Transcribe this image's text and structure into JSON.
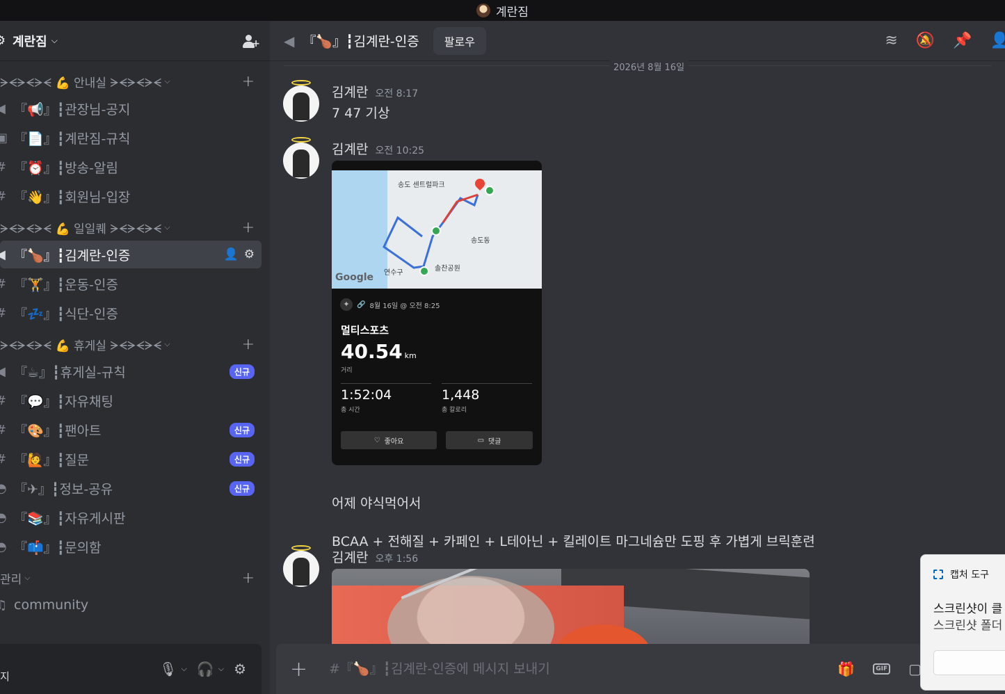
{
  "window": {
    "title": "계란짐"
  },
  "server": {
    "name": "계란짐"
  },
  "categories": [
    {
      "label": "ᗒᗕᗒᗕᗒᗕ 💪 안내실 ᗒᗕᗒᗕᗒᗕ"
    },
    {
      "label": "ᗒᗕᗒᗕᗒᗕ 💪 일일퀘 ᗒᗕᗒᗕᗒᗕ"
    },
    {
      "label": "ᗒᗕᗒᗕᗒᗕ 💪 휴게실 ᗒᗕᗒᗕᗒᗕ"
    },
    {
      "label": "관리"
    }
  ],
  "channels": {
    "info": [
      {
        "icon": "📢",
        "name": "『📢』┇관장님-공지"
      },
      {
        "icon": "📄",
        "name": "『📄』┇계란짐-규칙"
      },
      {
        "icon": "#",
        "name": "『⏰』┇방송-알림"
      },
      {
        "icon": "#",
        "name": "『👋』┇회원님-입장"
      }
    ],
    "daily": [
      {
        "icon": "📢",
        "name": "『🍗』┇김계란-인증"
      },
      {
        "icon": "#",
        "name": "『🏋』┇운동-인증"
      },
      {
        "icon": "#",
        "name": "『💤』┇식단-인증"
      }
    ],
    "lounge": [
      {
        "icon": "📢",
        "name": "『☕』┇휴게실-규칙",
        "badge": "신규"
      },
      {
        "icon": "#",
        "name": "『💬』┇자유채팅"
      },
      {
        "icon": "#",
        "name": "『🎨』┇팬아트",
        "badge": "신규"
      },
      {
        "icon": "💬",
        "name": "『🙋』┇질문",
        "badge": "신규"
      },
      {
        "icon": "💬",
        "name": "『✈』┇정보-공유",
        "badge": "신규"
      },
      {
        "icon": "💬",
        "name": "『📚』┇자유게시판"
      },
      {
        "icon": "💬",
        "name": "『📫』┇문의함"
      }
    ],
    "admin": [
      {
        "icon": "🔊",
        "name": "community"
      }
    ]
  },
  "user_panel": {
    "status": "지"
  },
  "chat": {
    "channel_title": "『🍗』┇김계란-인증",
    "follow_label": "팔로우",
    "date_divider": "2026년 8월 16일",
    "composer_placeholder": "#『🍗』┇김계란-인증에 메시지 보내기"
  },
  "messages": [
    {
      "author": "김계란",
      "time": "오전 8:17",
      "text": "7 47 기상"
    },
    {
      "author": "김계란",
      "time": "오전 10:25",
      "text1": "어제 야식먹어서",
      "text2": "BCAA + 전해질 + 카페인 + L테아닌 + 킬레이트 마그네슘만 도핑 후 가볍게 브릭훈련"
    },
    {
      "author": "김계란",
      "time": "오후 1:56"
    }
  ],
  "activity": {
    "meta": "8월 16일 @ 오전 8:25",
    "map_label_park": "송도 센트럴파크",
    "map_label_park2": "솔찬공원",
    "map_label_district": "송도동",
    "map_label_district2": "연수구",
    "map_brand": "Google",
    "type": "멀티스포츠",
    "distance": "40.54",
    "distance_unit": "km",
    "distance_label": "거리",
    "time_value": "1:52:04",
    "time_label": "총 시간",
    "cal_value": "1,448",
    "cal_label": "총 칼로리",
    "like_label": "좋아요",
    "comment_label": "댓글"
  },
  "toast": {
    "app_name": "캡처 도구",
    "line1": "스크린샷이 클",
    "line2": "스크린샷 폴더"
  },
  "colors": {
    "accent": "#5865f2",
    "bg_main": "#313338",
    "bg_sidebar": "#2b2d31"
  }
}
